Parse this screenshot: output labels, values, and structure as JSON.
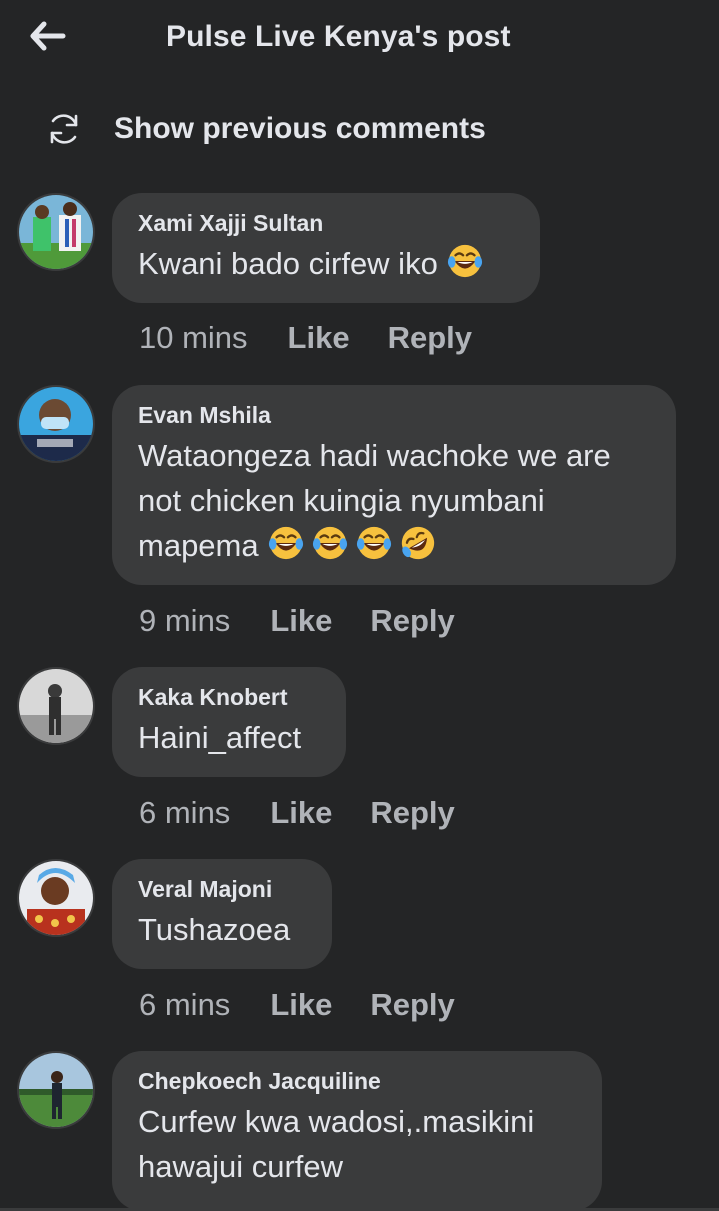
{
  "header": {
    "title": "Pulse Live Kenya's post",
    "back_icon": "arrow-left-icon"
  },
  "previous": {
    "label": "Show previous comments",
    "icon": "refresh-icon"
  },
  "comments": [
    {
      "author": "Xami Xajji Sultan",
      "text": "Kwani bado cirfew iko",
      "emojis": [
        "tears-of-joy"
      ],
      "time": "10 mins",
      "like": "Like",
      "reply": "Reply"
    },
    {
      "author": "Evan Mshila",
      "text_line1": "Wataongeza hadi wachoke we are",
      "text_line2": "not chicken kuingia nyumbani",
      "text_line3": "mapema",
      "emojis": [
        "tears-of-joy",
        "tears-of-joy",
        "tears-of-joy",
        "rolling-on-floor-laughing"
      ],
      "time": "9 mins",
      "like": "Like",
      "reply": "Reply"
    },
    {
      "author": "Kaka Knobert",
      "text": "Haini_affect",
      "time": "6 mins",
      "like": "Like",
      "reply": "Reply"
    },
    {
      "author": "Veral Majoni",
      "text": "Tushazoea",
      "time": "6 mins",
      "like": "Like",
      "reply": "Reply"
    },
    {
      "author": "Chepkoech Jacquiline",
      "text_line1": "Curfew kwa wadosi,.masikini",
      "text_line2": "hawajui curfew"
    }
  ],
  "colors": {
    "background": "#242526",
    "bubble": "#3a3b3c",
    "primary_text": "#e4e6eb",
    "secondary_text": "#b0b3b8"
  }
}
